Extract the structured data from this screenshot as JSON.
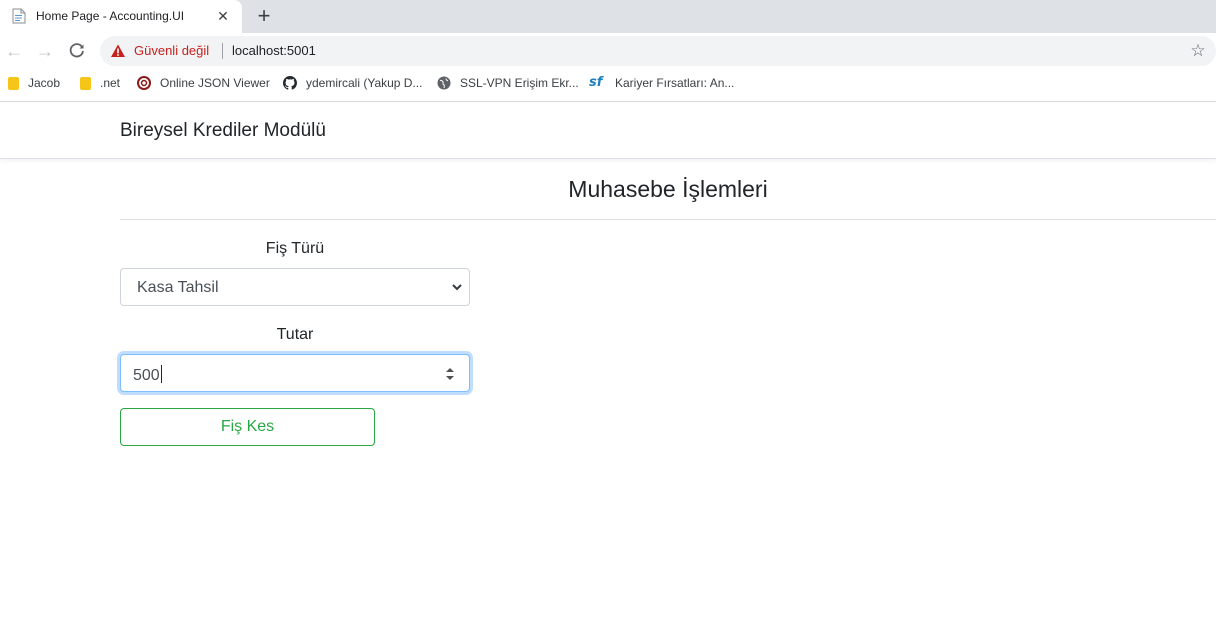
{
  "browser": {
    "tab_title": "Home Page - Accounting.UI",
    "tab_close_icon": "close-icon",
    "new_tab_icon": "plus-icon",
    "security_label": "Güvenli değil",
    "url": "localhost:5001",
    "bookmarks": [
      {
        "label": "Jacob",
        "icon": "folder-icon"
      },
      {
        "label": ".net",
        "icon": "folder-icon"
      },
      {
        "label": "Online JSON Viewer",
        "icon": "json-viewer-icon"
      },
      {
        "label": "ydemircali (Yakup D...",
        "icon": "github-icon"
      },
      {
        "label": "SSL-VPN Erişim Ekr...",
        "icon": "globe-icon"
      },
      {
        "label": "Kariyer Fırsatları: An...",
        "icon": "sf-icon"
      }
    ]
  },
  "navbar": {
    "brand": "Bireysel Krediler Modülü"
  },
  "main": {
    "title": "Muhasebe İşlemleri",
    "form": {
      "type_label": "Fiş Türü",
      "type_selected": "Kasa Tahsil",
      "amount_label": "Tutar",
      "amount_value": "500",
      "submit_label": "Fiş Kes"
    }
  },
  "colors": {
    "accent_success": "#28a745",
    "focus_border": "#80bdff",
    "warning_red": "#c5221f"
  }
}
